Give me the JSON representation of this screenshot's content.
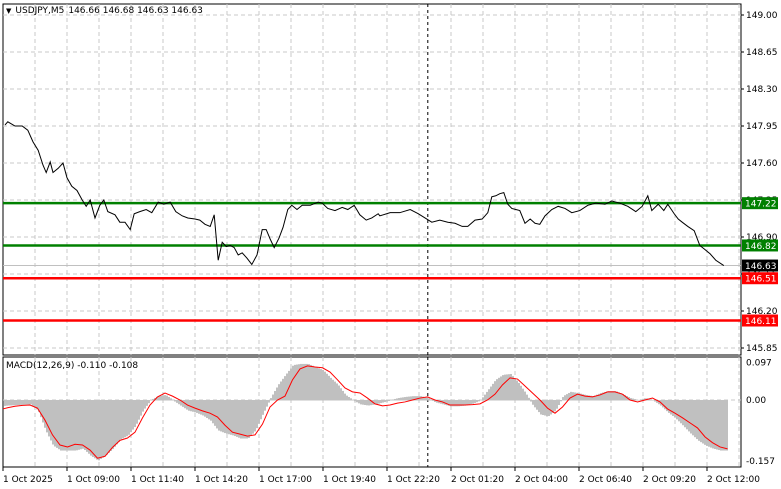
{
  "header": {
    "symbol": "USDJPY,M5",
    "ohlc": "146.66 146.68 146.63 146.63",
    "toggle_icon": "triangle-down-icon"
  },
  "colors": {
    "support_resistance": "#008000",
    "target": "#ff0000",
    "price_line": "#000000",
    "histogram": "#c0c0c0",
    "signal": "#ff0000",
    "current_box": "#000000"
  },
  "price_axis": {
    "ticks": [
      "149.00",
      "148.65",
      "148.30",
      "147.95",
      "147.60",
      "147.25",
      "146.90",
      "146.55",
      "146.20",
      "145.85"
    ],
    "min": 145.72,
    "max": 149.1
  },
  "levels": [
    {
      "label": "147.22",
      "value": 147.22,
      "color": "#008000"
    },
    {
      "label": "146.82",
      "value": 146.82,
      "color": "#008000"
    },
    {
      "label": "146.51",
      "value": 146.51,
      "color": "#ff0000"
    },
    {
      "label": "146.11",
      "value": 146.11,
      "color": "#ff0000"
    }
  ],
  "current_price": {
    "label": "146.63",
    "value": 146.63
  },
  "time_axis": {
    "labels": [
      "1 Oct 2025",
      "1 Oct 09:00",
      "1 Oct 11:40",
      "1 Oct 14:20",
      "1 Oct 17:00",
      "1 Oct 19:40",
      "1 Oct 22:20",
      "2 Oct 01:20",
      "2 Oct 04:00",
      "2 Oct 06:40",
      "2 Oct 09:20",
      "2 Oct 12:00"
    ],
    "label_step_min": 160,
    "separator_min": 1062
  },
  "chart_data": [
    {
      "type": "line",
      "title": "USDJPY,M5",
      "x_unit": "minutes since first axis label",
      "t": [
        5,
        12,
        30,
        48,
        62,
        75,
        88,
        100,
        108,
        118,
        125,
        138,
        150,
        160,
        172,
        185,
        198,
        208,
        218,
        230,
        242,
        252,
        262,
        280,
        292,
        305,
        318,
        328,
        342,
        358,
        372,
        388,
        402,
        418,
        432,
        448,
        462,
        480,
        492,
        505,
        518,
        528,
        538,
        548,
        558,
        568,
        578,
        588,
        598,
        610,
        622,
        635,
        648,
        658,
        668,
        678,
        690,
        700,
        712,
        722,
        735,
        748,
        768,
        788,
        798,
        812,
        830,
        848,
        862,
        878,
        892,
        908,
        922,
        938,
        942,
        968,
        992,
        1018,
        1038,
        1055,
        1072,
        1092,
        1112,
        1130,
        1148,
        1162,
        1180,
        1198,
        1212,
        1222,
        1232,
        1242,
        1252,
        1262,
        1272,
        1282,
        1292,
        1305,
        1318,
        1330,
        1342,
        1355,
        1372,
        1388,
        1405,
        1422,
        1442,
        1462,
        1482,
        1505,
        1522,
        1542,
        1562,
        1582,
        1598,
        1612,
        1622,
        1638,
        1652,
        1662,
        1678,
        1688,
        1698,
        1712,
        1728,
        1742,
        1752,
        1768,
        1782,
        1802
      ],
      "price": [
        147.96,
        147.99,
        147.95,
        147.95,
        147.91,
        147.8,
        147.72,
        147.58,
        147.51,
        147.61,
        147.51,
        147.55,
        147.6,
        147.46,
        147.38,
        147.34,
        147.25,
        147.19,
        147.25,
        147.08,
        147.2,
        147.25,
        147.14,
        147.11,
        147.04,
        147.04,
        146.97,
        147.12,
        147.14,
        147.16,
        147.13,
        147.23,
        147.21,
        147.23,
        147.14,
        147.1,
        147.08,
        147.07,
        147.06,
        147.02,
        147.0,
        147.11,
        146.68,
        146.85,
        146.81,
        146.82,
        146.8,
        146.73,
        146.75,
        146.7,
        146.64,
        146.73,
        146.97,
        146.97,
        146.88,
        146.8,
        146.89,
        146.99,
        147.16,
        147.2,
        147.16,
        147.2,
        147.2,
        147.23,
        147.22,
        147.17,
        147.15,
        147.18,
        147.16,
        147.2,
        147.11,
        147.06,
        147.08,
        147.12,
        147.1,
        147.13,
        147.13,
        147.16,
        147.12,
        147.08,
        147.04,
        147.06,
        147.04,
        147.03,
        147.0,
        147.0,
        147.06,
        147.07,
        147.13,
        147.28,
        147.29,
        147.31,
        147.32,
        147.21,
        147.17,
        147.16,
        147.15,
        147.03,
        147.07,
        147.03,
        147.02,
        147.1,
        147.16,
        147.19,
        147.17,
        147.13,
        147.15,
        147.2,
        147.22,
        147.21,
        147.24,
        147.22,
        147.19,
        147.14,
        147.19,
        147.29,
        147.15,
        147.21,
        147.15,
        147.21,
        147.12,
        147.07,
        147.04,
        147.0,
        146.96,
        146.82,
        146.79,
        146.74,
        146.68,
        146.63
      ]
    },
    {
      "type": "bar",
      "title": "MACD(12,26,9)",
      "values_label": "-0.110 -0.108",
      "yticks": [
        "0.097",
        "0.00",
        "-0.157"
      ],
      "ylim": [
        -0.157,
        0.097
      ],
      "t_start": -7.5,
      "t_step": 18.75,
      "histogram": [
        -0.015,
        -0.013,
        -0.012,
        -0.011,
        -0.01,
        -0.026,
        -0.077,
        -0.116,
        -0.129,
        -0.129,
        -0.129,
        -0.124,
        -0.142,
        -0.155,
        -0.142,
        -0.124,
        -0.1,
        -0.09,
        -0.065,
        -0.026,
        0.0,
        0.01,
        0.013,
        0.0,
        -0.013,
        -0.026,
        -0.031,
        -0.039,
        -0.052,
        -0.077,
        -0.085,
        -0.09,
        -0.098,
        -0.098,
        -0.077,
        -0.034,
        0.005,
        0.039,
        0.065,
        0.09,
        0.093,
        0.093,
        0.085,
        0.077,
        0.057,
        0.039,
        0.013,
        0.0,
        -0.01,
        -0.013,
        -0.01,
        -0.005,
        0.0,
        0.005,
        0.008,
        0.01,
        0.01,
        0.005,
        -0.005,
        -0.01,
        -0.015,
        -0.015,
        -0.013,
        -0.008,
        0.0,
        0.026,
        0.052,
        0.065,
        0.067,
        0.046,
        0.018,
        -0.013,
        -0.036,
        -0.041,
        -0.026,
        0.01,
        0.021,
        0.018,
        0.013,
        0.01,
        0.018,
        0.023,
        0.023,
        0.015,
        0.005,
        0.0,
        0.005,
        0.0,
        -0.013,
        -0.031,
        -0.046,
        -0.065,
        -0.085,
        -0.103,
        -0.116,
        -0.124,
        -0.129,
        -0.129
      ],
      "signal": [
        -0.023,
        -0.02,
        -0.016,
        -0.014,
        -0.013,
        -0.021,
        -0.052,
        -0.09,
        -0.116,
        -0.121,
        -0.114,
        -0.116,
        -0.129,
        -0.15,
        -0.145,
        -0.122,
        -0.104,
        -0.098,
        -0.083,
        -0.046,
        -0.013,
        0.008,
        0.018,
        0.01,
        0.0,
        -0.013,
        -0.021,
        -0.028,
        -0.034,
        -0.044,
        -0.065,
        -0.083,
        -0.088,
        -0.093,
        -0.09,
        -0.062,
        -0.018,
        0.0,
        0.01,
        0.052,
        0.08,
        0.088,
        0.085,
        0.083,
        0.072,
        0.052,
        0.031,
        0.021,
        0.018,
        0.005,
        -0.01,
        -0.015,
        -0.013,
        -0.008,
        -0.005,
        0.0,
        0.005,
        0.008,
        0.0,
        -0.005,
        -0.013,
        -0.013,
        -0.013,
        -0.012,
        -0.01,
        0.0,
        0.015,
        0.039,
        0.057,
        0.054,
        0.036,
        0.018,
        0.0,
        -0.021,
        -0.034,
        -0.018,
        0.005,
        0.015,
        0.01,
        0.008,
        0.013,
        0.021,
        0.021,
        0.015,
        0.0,
        -0.005,
        0.0,
        0.005,
        -0.005,
        -0.023,
        -0.034,
        -0.046,
        -0.059,
        -0.072,
        -0.095,
        -0.11,
        -0.121,
        -0.126
      ]
    }
  ]
}
